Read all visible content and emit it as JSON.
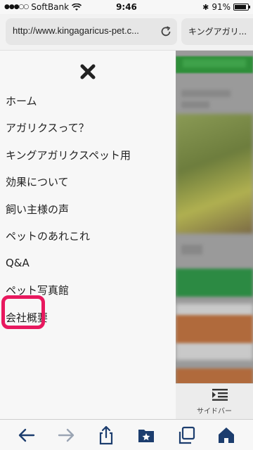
{
  "status_bar": {
    "carrier": "SoftBank",
    "time": "9:46",
    "battery": "91%",
    "battery_level": 0.91
  },
  "browser": {
    "url": "http://www.kingagaricus-pet.c...",
    "tab2_title": "キングアガリ..."
  },
  "drawer": {
    "items": [
      {
        "label": "ホーム"
      },
      {
        "label": "アガリクスって？"
      },
      {
        "label": "キングアガリクスペット用"
      },
      {
        "label": "効果について"
      },
      {
        "label": "飼い主様の声"
      },
      {
        "label": "ペットのあれこれ"
      },
      {
        "label": "Q&A"
      },
      {
        "label": "ペット写真館"
      },
      {
        "label": "会社概要"
      }
    ]
  },
  "sidebar_button": {
    "label": "サイドバー"
  },
  "colors": {
    "highlight": "#e8185e",
    "toolbar_icon": "#1c3d6e"
  },
  "toolbar": {
    "icons": [
      "back-arrow-icon",
      "forward-arrow-icon",
      "share-icon",
      "bookmarks-icon",
      "tabs-icon",
      "home-icon"
    ]
  }
}
